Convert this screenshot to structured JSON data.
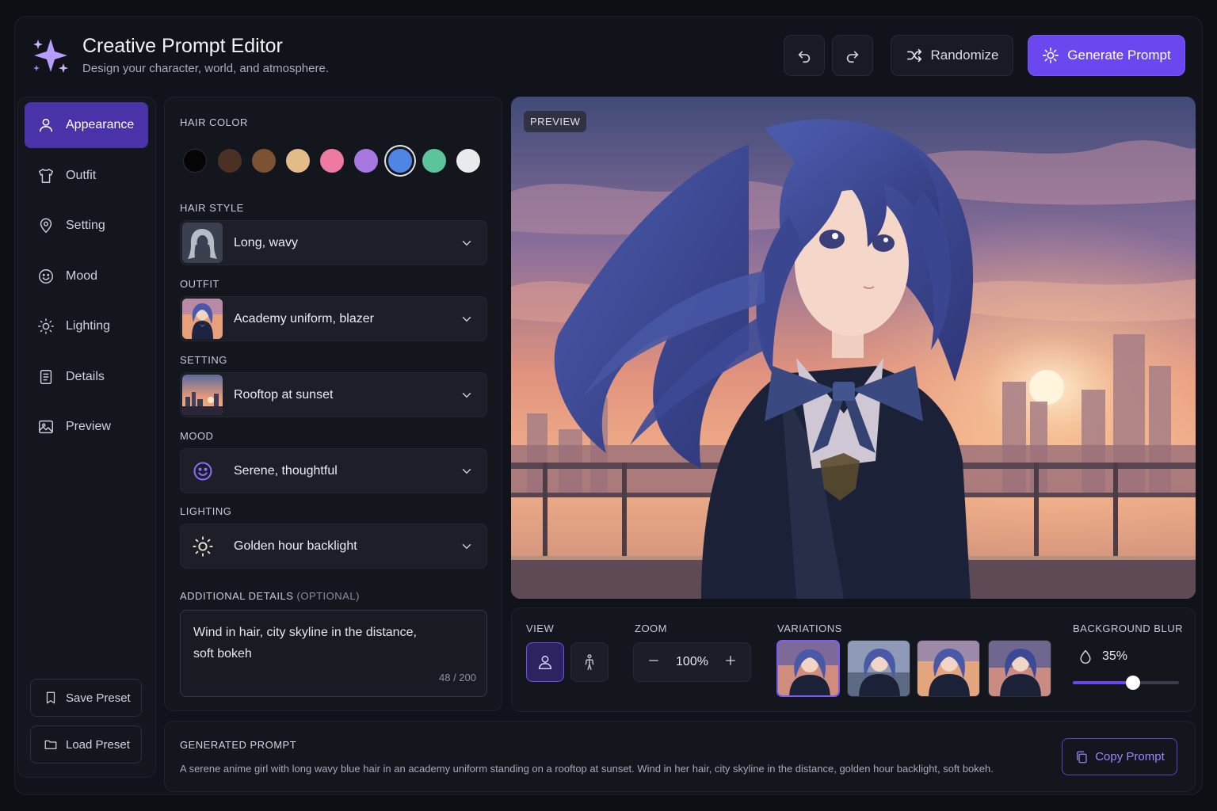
{
  "header": {
    "title": "Creative Prompt Editor",
    "subtitle": "Design your character, world, and atmosphere.",
    "randomize_label": "Randomize",
    "generate_label": "Generate Prompt"
  },
  "sidebar": {
    "items": [
      {
        "label": "Appearance",
        "icon": "user-icon",
        "active": true
      },
      {
        "label": "Outfit",
        "icon": "shirt-icon"
      },
      {
        "label": "Setting",
        "icon": "map-pin-icon"
      },
      {
        "label": "Mood",
        "icon": "smile-icon"
      },
      {
        "label": "Lighting",
        "icon": "sun-icon"
      },
      {
        "label": "Details",
        "icon": "document-icon"
      },
      {
        "label": "Preview",
        "icon": "image-icon"
      }
    ],
    "save_preset": "Save Preset",
    "load_preset": "Load Preset"
  },
  "controls": {
    "hair_color_label": "HAIR COLOR",
    "hair_colors": [
      "#050505",
      "#4a3124",
      "#7d5233",
      "#e2bb88",
      "#ef7aa1",
      "#a678e0",
      "#4f86e6",
      "#5cc49a",
      "#e9eaec"
    ],
    "selected_hair_color": "#4f86e6",
    "hair_style_label": "HAIR STYLE",
    "hair_style_value": "Long, wavy",
    "outfit_label": "OUTFIT",
    "outfit_value": "Academy uniform, blazer",
    "setting_label": "SETTING",
    "setting_value": "Rooftop at sunset",
    "mood_label": "MOOD",
    "mood_value": "Serene, thoughtful",
    "lighting_label": "LIGHTING",
    "lighting_value": "Golden hour backlight",
    "details_label": "ADDITIONAL DETAILS",
    "details_optional": "(OPTIONAL)",
    "details_line1": "Wind in hair, city skyline in the distance,",
    "details_line2": "soft bokeh",
    "details_counter": "48 / 200"
  },
  "preview": {
    "badge": "PREVIEW"
  },
  "tools": {
    "view_label": "VIEW",
    "zoom_label": "ZOOM",
    "zoom_value": "100%",
    "variations_label": "VARIATIONS",
    "variations_count": 4,
    "selected_variation": 1,
    "blur_label": "BACKGROUND BLUR",
    "blur_value": "35%",
    "blur_fraction": 0.57
  },
  "generated": {
    "label": "GENERATED PROMPT",
    "text": "A serene anime girl with long wavy blue hair in an academy uniform standing on a rooftop at sunset. Wind in her hair, city skyline in the distance, golden hour backlight, soft bokeh.",
    "copy_label": "Copy Prompt"
  },
  "colors": {
    "accent": "#6b47f0",
    "background": "#0d0f14",
    "panel": "#14161e"
  }
}
